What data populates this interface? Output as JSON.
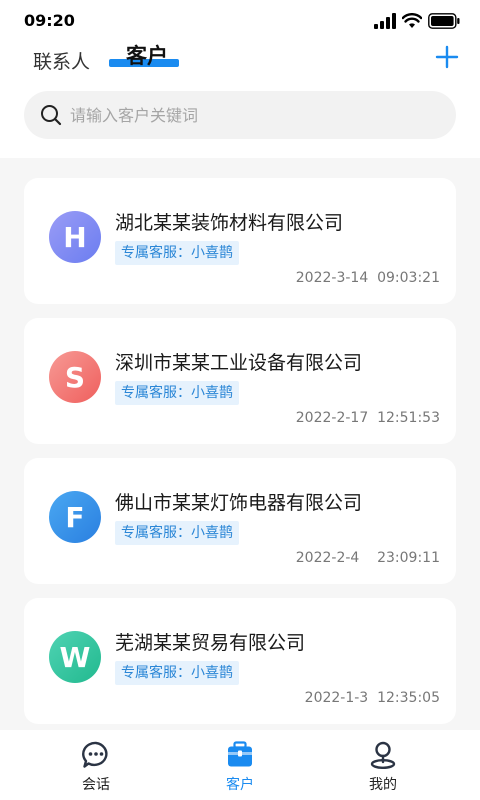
{
  "status_bar": {
    "time": "09:20"
  },
  "tabs": {
    "contacts": "联系人",
    "customers": "客户"
  },
  "search": {
    "placeholder": "请输入客户关键词"
  },
  "customers": [
    {
      "initial": "H",
      "name": "湖北某某装饰材料有限公司",
      "tag": "专属客服：小喜鹊",
      "time": "2022-3-14  09:03:21",
      "color_from": "#9a9cf6",
      "color_to": "#6b7df0"
    },
    {
      "initial": "S",
      "name": "深圳市某某工业设备有限公司",
      "tag": "专属客服：小喜鹊",
      "time": "2022-2-17  12:51:53",
      "color_from": "#f79a95",
      "color_to": "#ef5f5d"
    },
    {
      "initial": "F",
      "name": "佛山市某某灯饰电器有限公司",
      "tag": "专属客服：小喜鹊",
      "time": "2022-2-4    23:09:11",
      "color_from": "#4aa8f2",
      "color_to": "#2a7fe0"
    },
    {
      "initial": "W",
      "name": "芜湖某某贸易有限公司",
      "tag": "专属客服：小喜鹊",
      "time": "2022-1-3  12:35:05",
      "color_from": "#4fd3b3",
      "color_to": "#22b98f"
    }
  ],
  "bottom_nav": {
    "chat": "会话",
    "customers": "客户",
    "mine": "我的"
  },
  "colors": {
    "accent": "#1a8bf0",
    "tag_bg": "#e6f2fd",
    "tag_text": "#2a86d6"
  },
  "icons": {
    "signal": "cellular-signal-icon",
    "wifi": "wifi-icon",
    "battery": "battery-icon",
    "add": "plus-icon",
    "search": "search-icon",
    "chat": "chat-bubble-icon",
    "customers": "briefcase-icon",
    "mine": "user-pin-icon"
  }
}
